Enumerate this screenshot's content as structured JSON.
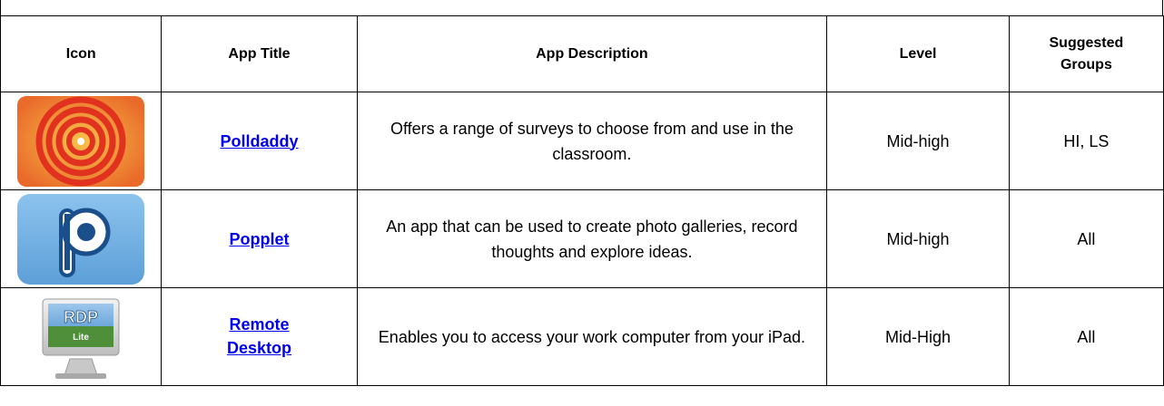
{
  "table": {
    "headers": {
      "icon": "Icon",
      "title": "App Title",
      "description": "App Description",
      "level": "Level",
      "groups_line1": "Suggested",
      "groups_line2": "Groups"
    },
    "rows": [
      {
        "icon": "polldaddy-spiral-icon",
        "title": "Polldaddy",
        "description": "Offers a range of surveys to choose from and use in the classroom.",
        "level": "Mid-high",
        "groups": "HI, LS"
      },
      {
        "icon": "popplet-p-icon",
        "title": "Popplet",
        "description": "An app that can be used to create photo galleries, record thoughts and explore ideas.",
        "level": "Mid-high",
        "groups": "All"
      },
      {
        "icon": "remote-desktop-monitor-icon",
        "icon_text_top": "RDP",
        "icon_text_bottom": "Lite",
        "title": "Remote Desktop",
        "description": "Enables you to access your work computer from your iPad.",
        "level": "Mid-High",
        "groups": "All"
      }
    ]
  },
  "colors": {
    "link": "#0000ee",
    "border": "#000000"
  }
}
